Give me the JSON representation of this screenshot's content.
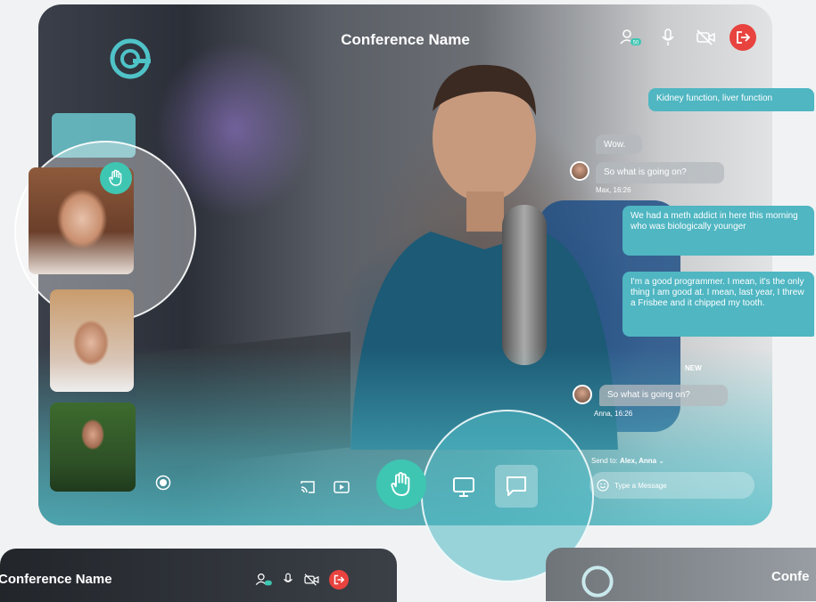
{
  "app": {
    "title": "Conference Name"
  },
  "top_bar": {
    "participants_badge": "50",
    "icons": [
      "participants-icon",
      "microphone-icon",
      "camera-off-icon",
      "exit-icon"
    ]
  },
  "chat": {
    "messages": [
      {
        "text": "Kidney function, liver function",
        "kind": "outgoing"
      },
      {
        "text": "Wow.",
        "kind": "incoming"
      },
      {
        "text": "So what is going on?",
        "kind": "incoming",
        "author_time": "Max, 16:26"
      },
      {
        "text": "We had a meth addict in here this morning who was biologically younger",
        "kind": "outgoing"
      },
      {
        "text": "I'm a good programmer. I mean, it's the only thing I am good at. I mean, last year, I threw a Frisbee and it chipped my tooth.",
        "kind": "outgoing"
      },
      {
        "text": "So what is going on?",
        "kind": "incoming",
        "author_time": "Anna, 16:26"
      }
    ],
    "new_label": "NEW",
    "send_to_prefix": "Send to:",
    "send_to_names": "Alex, Anna",
    "input_placeholder": "Type a Message"
  },
  "colors": {
    "accent": "#3ec6b2",
    "bubble": "#4fb6c2",
    "danger": "#e8433f"
  },
  "bottom_mockups": {
    "left_title": "Conference Name",
    "right_title": "Confe"
  }
}
